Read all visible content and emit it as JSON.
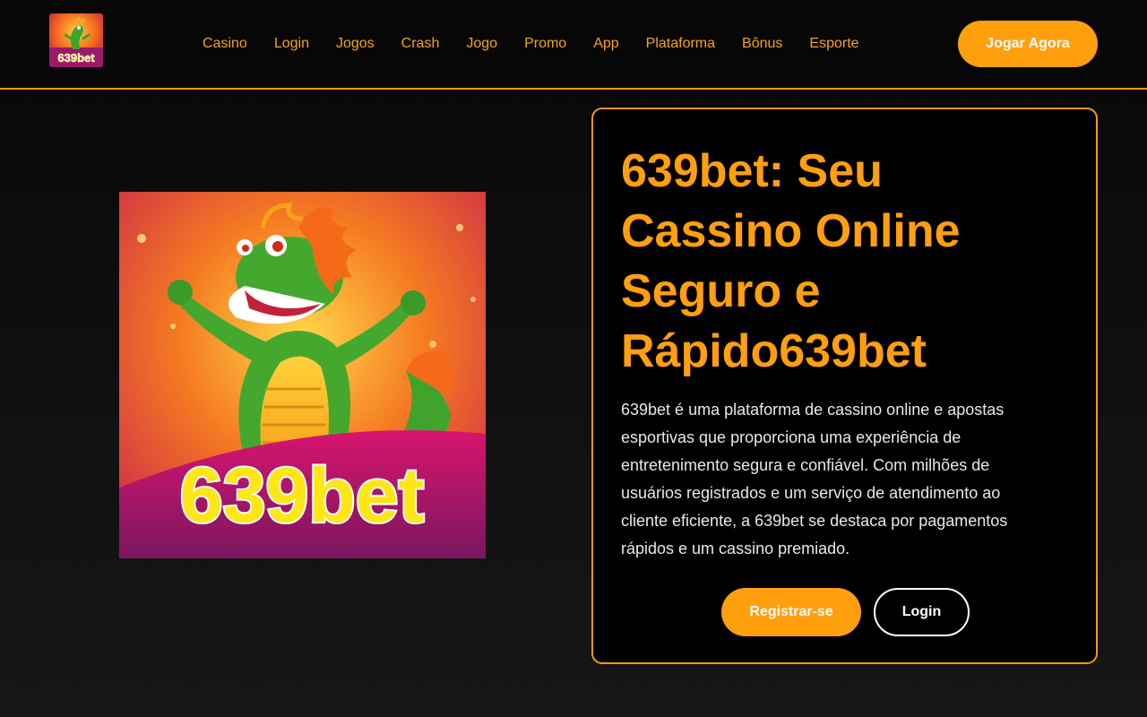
{
  "header": {
    "logo_text": "639bet",
    "nav": [
      "Casino",
      "Login",
      "Jogos",
      "Crash",
      "Jogo",
      "Promo",
      "App",
      "Plataforma",
      "Bônus",
      "Esporte"
    ],
    "cta_label": "Jogar Agora"
  },
  "hero": {
    "image_text": "639bet",
    "image_subject": "dragon-mascot"
  },
  "card": {
    "title": "639bet: Seu Cassino Online Seguro e Rápido639bet",
    "description": "639bet é uma plataforma de cassino online e apostas esportivas que proporciona uma experiência de entretenimento segura e confiável. Com milhões de usuários registrados e um serviço de atendimento ao cliente eficiente, a 639bet se destaca por pagamentos rápidos e um cassino premiado.",
    "register_label": "Registrar-se",
    "login_label": "Login"
  },
  "colors": {
    "accent": "#ff9f0e",
    "background": "#0a0a0a",
    "text": "#ffffff"
  }
}
